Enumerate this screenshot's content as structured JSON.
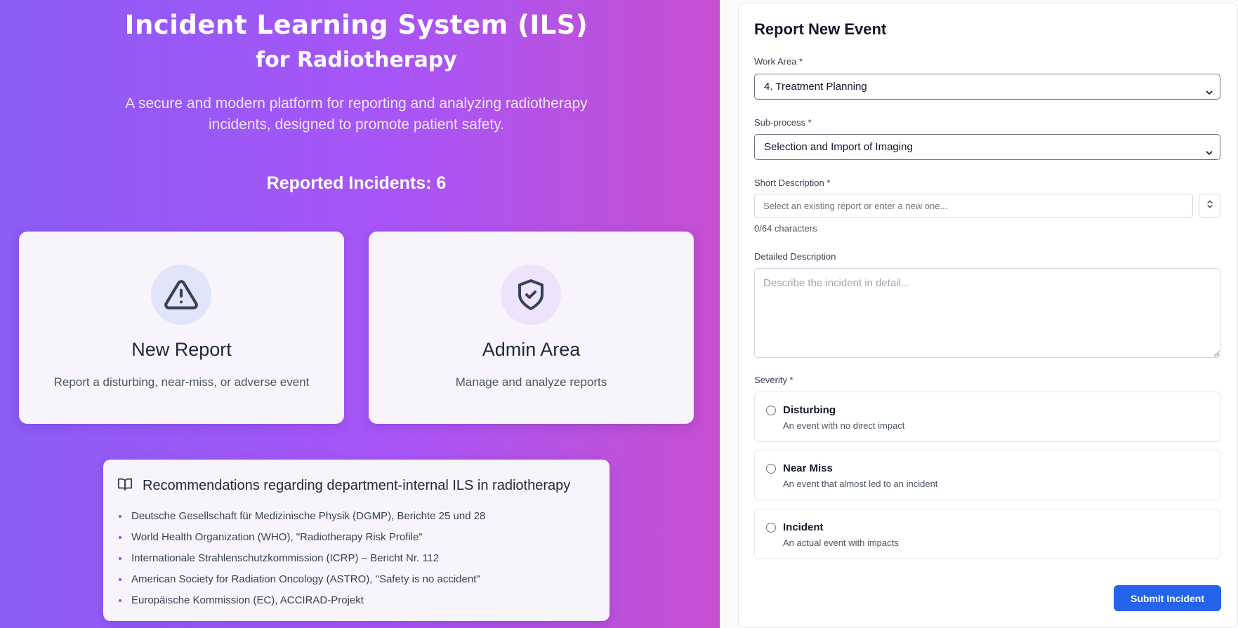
{
  "hero": {
    "title": "Incident Learning System (ILS)",
    "subtitle": "for Radiotherapy",
    "description": "A secure and modern platform for reporting and analyzing radiotherapy incidents, designed to promote patient safety.",
    "reported_incidents": "Reported Incidents: 6"
  },
  "cards": {
    "new_report": {
      "title": "New Report",
      "description": "Report a disturbing, near-miss, or adverse event",
      "icon": "warning-triangle-icon"
    },
    "admin": {
      "title": "Admin Area",
      "description": "Manage and analyze reports",
      "icon": "shield-check-icon"
    }
  },
  "recommendations": {
    "title": "Recommendations regarding department-internal ILS in radiotherapy",
    "icon": "open-book-icon",
    "items": [
      "Deutsche Gesellschaft für Medizinische Physik (DGMP), Berichte 25 und 28",
      "World Health Organization (WHO), \"Radiotherapy Risk Profile\"",
      "Internationale Strahlenschutzkommission (ICRP) – Bericht Nr. 112",
      "American Society for Radiation Oncology (ASTRO), \"Safety is no accident\"",
      "Europäische Kommission (EC), ACCIRAD-Projekt"
    ]
  },
  "form": {
    "title": "Report New Event",
    "work_area": {
      "label": "Work Area *",
      "value": "4. Treatment Planning"
    },
    "sub_process": {
      "label": "Sub-process *",
      "value": "Selection and Import of Imaging"
    },
    "short_description": {
      "label": "Short Description *",
      "placeholder": "Select an existing report or enter a new one...",
      "char_count": "0/64 characters"
    },
    "detailed_description": {
      "label": "Detailed Description",
      "placeholder": "Describe the incident in detail..."
    },
    "severity": {
      "label": "Severity *",
      "options": [
        {
          "name": "Disturbing",
          "description": "An event with no direct impact"
        },
        {
          "name": "Near Miss",
          "description": "An event that almost led to an incident"
        },
        {
          "name": "Incident",
          "description": "An actual event with impacts"
        }
      ]
    },
    "submit_label": "Submit Incident"
  },
  "colors": {
    "gradient_start": "#8b5cf6",
    "gradient_end": "#c54fcf",
    "primary_button": "#2563eb"
  }
}
